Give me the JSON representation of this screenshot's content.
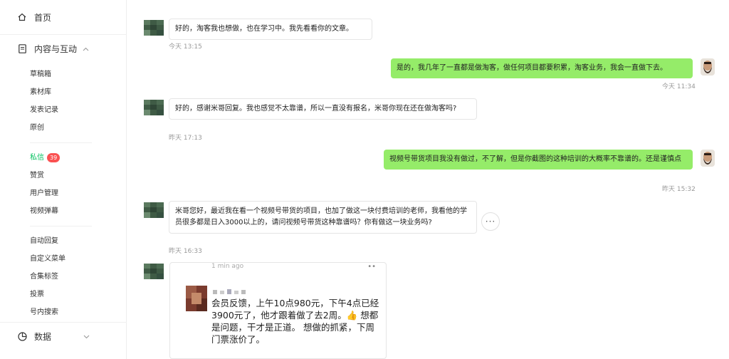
{
  "sidebar": {
    "home": "首页",
    "content_group": "内容与互动",
    "content_items": [
      "草稿箱",
      "素材库",
      "发表记录",
      "原创"
    ],
    "interaction_items": [
      {
        "label": "私信",
        "badge": "39",
        "active": true
      },
      {
        "label": "赞赏"
      },
      {
        "label": "用户管理"
      },
      {
        "label": "视频弹幕"
      }
    ],
    "tool_items": [
      "自动回复",
      "自定义菜单",
      "合集标签",
      "投票",
      "号内搜索"
    ],
    "data_group": "数据"
  },
  "messages": [
    {
      "dir": "in",
      "text": "好的，淘客我也想做，也在学习中。我先看看你的文章。",
      "time": "今天 13:15"
    },
    {
      "dir": "out",
      "text": "是的，我几年了一直都是做淘客，做任何项目都要积累，淘客业务，我会一直做下去。",
      "time": "今天 11:34"
    },
    {
      "dir": "in",
      "text": "好的，感谢米哥回复。我也感觉不太靠谱，所以一直没有报名，米哥你现在还在做淘客吗?",
      "time": "昨天 17:13"
    },
    {
      "dir": "out",
      "text": "视频号带货项目我没有做过，不了解，但是你截图的这种培训的大概率不靠谱的。还是谨慎点",
      "time": "昨天 15:32"
    },
    {
      "dir": "in",
      "text": "米哥您好，最近我在看一个视频号带货的项目，也加了做这一块付费培训的老师，我看他的学员很多都是日入3000以上的，请问视频号带货这种靠谱吗？你有做这一块业务吗?",
      "time": "昨天 16:33"
    }
  ],
  "image_card": {
    "top_time": "1 min ago",
    "post": "会员反馈，上午10点980元，下午4点已经3900元了，他才跟着做了去2周。👍 想都是问题，干才是正道。 想做的抓紧，下周门票涨价了。"
  },
  "colors": {
    "accent": "#07c160",
    "bubble_out": "#95ec69",
    "badge": "#fa5151"
  }
}
